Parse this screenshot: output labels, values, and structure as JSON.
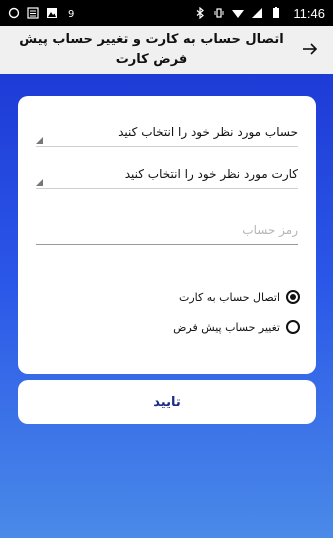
{
  "status_bar": {
    "time": "11:46",
    "left_icons": [
      "sync-icon",
      "news-icon",
      "image-icon",
      "nine-icon"
    ],
    "right_icons": [
      "bluetooth-icon",
      "vibrate-icon",
      "wifi-icon",
      "signal-icon",
      "battery-icon"
    ]
  },
  "appbar": {
    "title": "اتصال حساب به کارت و تغییر حساب پیش فرض کارت",
    "back_icon": "arrow-right-icon"
  },
  "form": {
    "account_select": "حساب مورد نظر خود را انتخاب کنید",
    "card_select": "کارت مورد نظر خود را انتخاب کنید",
    "password_placeholder": "رمز حساب",
    "options": [
      {
        "label": "اتصال حساب به کارت",
        "checked": true
      },
      {
        "label": "تغییر حساب پیش فرض",
        "checked": false
      }
    ]
  },
  "confirm_label": "تایید",
  "colors": {
    "gradient_top": "#1e3bd6",
    "gradient_bottom": "#4a8ae8",
    "button_text": "#1c2a88",
    "status_bar": "#000000"
  }
}
